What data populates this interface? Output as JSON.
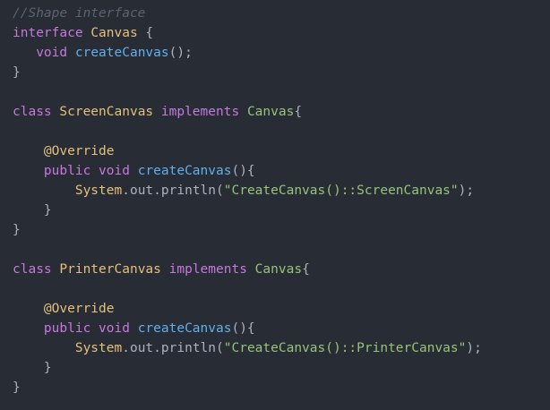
{
  "editor": {
    "theme_colors": {
      "background": "#282c34",
      "comment": "#5c6370",
      "keyword": "#c678dd",
      "class_name": "#e5c07b",
      "function": "#61afef",
      "string": "#98c379",
      "punctuation": "#abb2bf"
    },
    "lines": [
      [
        {
          "t": "comment",
          "v": "//Shape interface"
        }
      ],
      [
        {
          "t": "keyword",
          "v": "interface"
        },
        {
          "t": "plain",
          "v": " "
        },
        {
          "t": "class",
          "v": "Canvas"
        },
        {
          "t": "plain",
          "v": " {"
        }
      ],
      [
        {
          "t": "plain",
          "v": "   "
        },
        {
          "t": "keyword",
          "v": "void"
        },
        {
          "t": "plain",
          "v": " "
        },
        {
          "t": "function",
          "v": "createCanvas"
        },
        {
          "t": "punct",
          "v": "();"
        }
      ],
      [
        {
          "t": "punct",
          "v": "}"
        }
      ],
      [],
      [
        {
          "t": "keyword",
          "v": "class"
        },
        {
          "t": "plain",
          "v": " "
        },
        {
          "t": "class",
          "v": "ScreenCanvas"
        },
        {
          "t": "plain",
          "v": " "
        },
        {
          "t": "keyword",
          "v": "implements"
        },
        {
          "t": "plain",
          "v": " "
        },
        {
          "t": "iface",
          "v": "Canvas"
        },
        {
          "t": "punct",
          "v": "{"
        }
      ],
      [],
      [
        {
          "t": "plain",
          "v": "    "
        },
        {
          "t": "annotation",
          "v": "@Override"
        }
      ],
      [
        {
          "t": "plain",
          "v": "    "
        },
        {
          "t": "keyword",
          "v": "public"
        },
        {
          "t": "plain",
          "v": " "
        },
        {
          "t": "keyword",
          "v": "void"
        },
        {
          "t": "plain",
          "v": " "
        },
        {
          "t": "function",
          "v": "createCanvas"
        },
        {
          "t": "punct",
          "v": "(){"
        }
      ],
      [
        {
          "t": "plain",
          "v": "        "
        },
        {
          "t": "object",
          "v": "System"
        },
        {
          "t": "punct",
          "v": "."
        },
        {
          "t": "field",
          "v": "out"
        },
        {
          "t": "punct",
          "v": "."
        },
        {
          "t": "method",
          "v": "println"
        },
        {
          "t": "punct",
          "v": "("
        },
        {
          "t": "string",
          "v": "\"CreateCanvas()::ScreenCanvas\""
        },
        {
          "t": "punct",
          "v": ");"
        }
      ],
      [
        {
          "t": "plain",
          "v": "    "
        },
        {
          "t": "punct",
          "v": "}"
        }
      ],
      [
        {
          "t": "punct",
          "v": "}"
        }
      ],
      [],
      [
        {
          "t": "keyword",
          "v": "class"
        },
        {
          "t": "plain",
          "v": " "
        },
        {
          "t": "class",
          "v": "PrinterCanvas"
        },
        {
          "t": "plain",
          "v": " "
        },
        {
          "t": "keyword",
          "v": "implements"
        },
        {
          "t": "plain",
          "v": " "
        },
        {
          "t": "iface",
          "v": "Canvas"
        },
        {
          "t": "punct",
          "v": "{"
        }
      ],
      [],
      [
        {
          "t": "plain",
          "v": "    "
        },
        {
          "t": "annotation",
          "v": "@Override"
        }
      ],
      [
        {
          "t": "plain",
          "v": "    "
        },
        {
          "t": "keyword",
          "v": "public"
        },
        {
          "t": "plain",
          "v": " "
        },
        {
          "t": "keyword",
          "v": "void"
        },
        {
          "t": "plain",
          "v": " "
        },
        {
          "t": "function",
          "v": "createCanvas"
        },
        {
          "t": "punct",
          "v": "(){"
        }
      ],
      [
        {
          "t": "plain",
          "v": "        "
        },
        {
          "t": "object",
          "v": "System"
        },
        {
          "t": "punct",
          "v": "."
        },
        {
          "t": "field",
          "v": "out"
        },
        {
          "t": "punct",
          "v": "."
        },
        {
          "t": "method",
          "v": "println"
        },
        {
          "t": "punct",
          "v": "("
        },
        {
          "t": "string",
          "v": "\"CreateCanvas()::PrinterCanvas\""
        },
        {
          "t": "punct",
          "v": ");"
        }
      ],
      [
        {
          "t": "plain",
          "v": "    "
        },
        {
          "t": "punct",
          "v": "}"
        }
      ],
      [
        {
          "t": "punct",
          "v": "}"
        }
      ]
    ]
  }
}
